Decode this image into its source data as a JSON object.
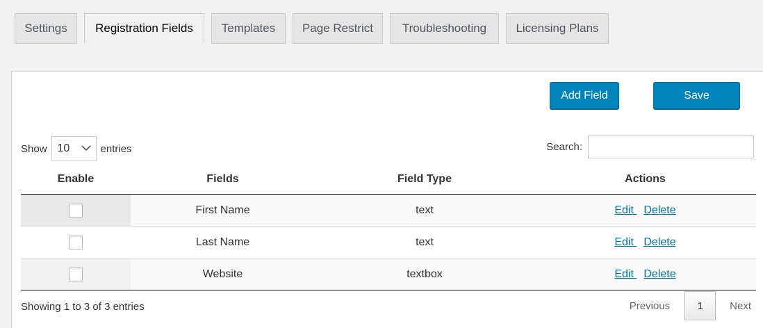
{
  "tabs": [
    {
      "label": "Settings"
    },
    {
      "label": "Registration Fields"
    },
    {
      "label": "Templates"
    },
    {
      "label": "Page Restrict"
    },
    {
      "label": "Troubleshooting"
    },
    {
      "label": "Licensing Plans"
    }
  ],
  "active_tab": "Registration Fields",
  "toolbar": {
    "add_field_label": "Add Field",
    "save_label": "Save"
  },
  "table_controls": {
    "show_label": "Show",
    "page_length": "10",
    "entries_label": "entries",
    "search_label": "Search:",
    "search_value": ""
  },
  "table": {
    "headers": [
      "Enable",
      "Fields",
      "Field Type",
      "Actions"
    ],
    "rows": [
      {
        "enabled": false,
        "field": "First Name",
        "type": "text",
        "edit_label": "Edit ",
        "delete_label": "Delete"
      },
      {
        "enabled": false,
        "field": "Last Name",
        "type": "text",
        "edit_label": "Edit ",
        "delete_label": "Delete"
      },
      {
        "enabled": false,
        "field": "Website",
        "type": "textbox",
        "edit_label": "Edit ",
        "delete_label": "Delete"
      }
    ]
  },
  "footer": {
    "info": "Showing 1 to 3 of 3 entries",
    "previous_label": "Previous",
    "current_page": "1",
    "next_label": "Next"
  },
  "colors": {
    "primary_button": "#0085ba",
    "link": "#0073aa"
  }
}
